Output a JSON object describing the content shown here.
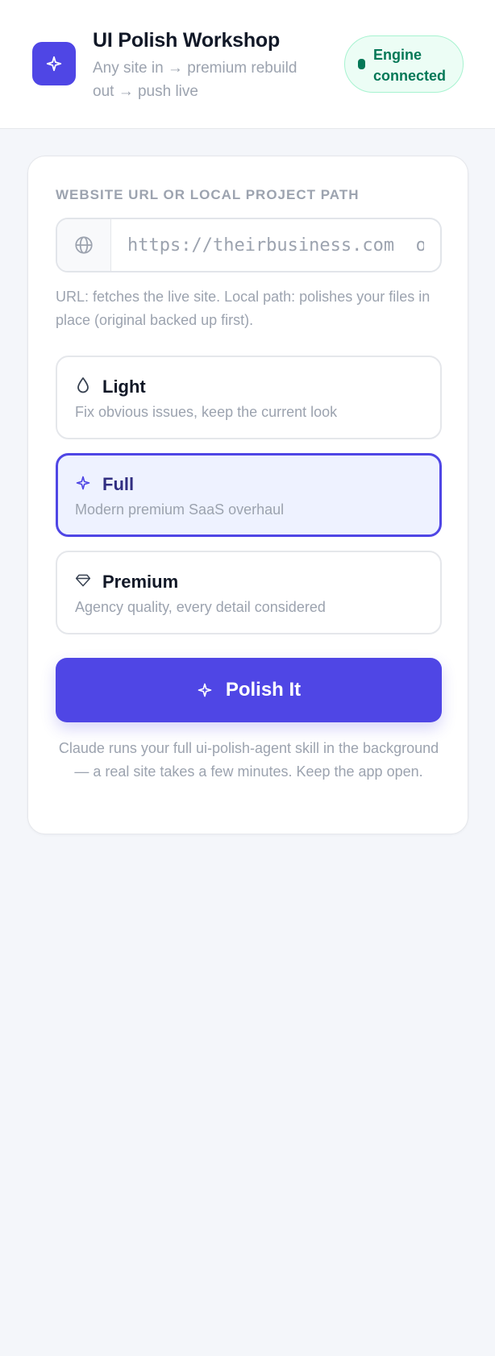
{
  "header": {
    "logo_icon": "sparkle-icon",
    "title": "UI Polish Workshop",
    "subtitle": "Any site in → premium rebuild out → push live",
    "status": {
      "label": "Engine connected",
      "color": "#047857"
    }
  },
  "form": {
    "field_label": "WEBSITE URL OR LOCAL PROJECT PATH",
    "url_icon": "globe-icon",
    "url_value": "",
    "url_placeholder": "https://theirbusiness.com  or  C:\\path\\to\\project",
    "help_text": "URL: fetches the live site. Local path: polishes your files in place (original backed up first).",
    "options": [
      {
        "icon": "droplet-icon",
        "title": "Light",
        "description": "Fix obvious issues, keep the current look",
        "selected": false
      },
      {
        "icon": "sparkle-icon",
        "title": "Full",
        "description": "Modern premium SaaS overhaul",
        "selected": true
      },
      {
        "icon": "diamond-icon",
        "title": "Premium",
        "description": "Agency quality, every detail considered",
        "selected": false
      }
    ],
    "submit_label": "Polish It",
    "submit_icon": "sparkle-icon",
    "footnote": "Claude runs your full ui-polish-agent skill in the background — a real site takes a few minutes. Keep the app open."
  },
  "colors": {
    "accent": "#4f46e5",
    "accent_soft": "#eef2ff",
    "success": "#047857",
    "success_bg": "#ecfdf5",
    "muted_text": "#9ca3af",
    "page_bg": "#f4f6fa"
  }
}
